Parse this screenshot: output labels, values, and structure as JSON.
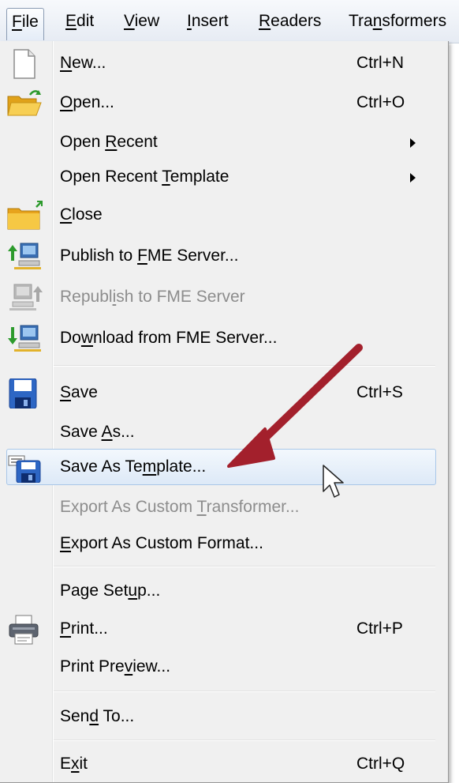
{
  "menubar": {
    "items": [
      {
        "pre": "",
        "acc": "F",
        "post": "ile"
      },
      {
        "pre": "",
        "acc": "E",
        "post": "dit"
      },
      {
        "pre": "",
        "acc": "V",
        "post": "iew"
      },
      {
        "pre": "",
        "acc": "I",
        "post": "nsert"
      },
      {
        "pre": "",
        "acc": "R",
        "post": "eaders"
      },
      {
        "pre": "Tra",
        "acc": "n",
        "post": "sformers"
      }
    ]
  },
  "file_menu": {
    "new": {
      "pre": "",
      "acc": "N",
      "post": "ew...",
      "shortcut": "Ctrl+N"
    },
    "open": {
      "pre": "",
      "acc": "O",
      "post": "pen...",
      "shortcut": "Ctrl+O"
    },
    "open_recent": {
      "pre": "Open ",
      "acc": "R",
      "post": "ecent"
    },
    "open_recent_template": {
      "pre": "Open Recent ",
      "acc": "T",
      "post": "emplate"
    },
    "close": {
      "pre": "",
      "acc": "C",
      "post": "lose"
    },
    "publish": {
      "pre": "Publish to ",
      "acc": "F",
      "post": "ME Server..."
    },
    "republish": {
      "pre": "Republ",
      "acc": "i",
      "post": "sh to FME Server"
    },
    "download": {
      "pre": "Do",
      "acc": "w",
      "post": "nload from FME Server..."
    },
    "save": {
      "pre": "",
      "acc": "S",
      "post": "ave",
      "shortcut": "Ctrl+S"
    },
    "save_as": {
      "pre": "Save ",
      "acc": "A",
      "post": "s..."
    },
    "save_as_template": {
      "pre": "Save As Te",
      "acc": "m",
      "post": "plate..."
    },
    "export_transformer": {
      "pre": "Export As Custom ",
      "acc": "T",
      "post": "ransformer..."
    },
    "export_format": {
      "pre": "",
      "acc": "E",
      "post": "xport As Custom Format..."
    },
    "page_setup": {
      "pre": "Page Set",
      "acc": "u",
      "post": "p..."
    },
    "print": {
      "pre": "",
      "acc": "P",
      "post": "rint...",
      "shortcut": "Ctrl+P"
    },
    "print_preview": {
      "pre": "Print Pre",
      "acc": "v",
      "post": "iew..."
    },
    "send_to": {
      "pre": "Sen",
      "acc": "d",
      "post": " To..."
    },
    "exit": {
      "pre": "E",
      "acc": "x",
      "post": "it",
      "shortcut": "Ctrl+Q"
    }
  },
  "icons": {
    "new": "new-document-icon",
    "open": "open-folder-icon",
    "close": "close-folder-icon",
    "publish": "publish-server-icon",
    "republish": "republish-server-icon",
    "download": "download-server-icon",
    "save": "save-disk-icon",
    "save_as_template": "save-template-icon",
    "print": "printer-icon"
  },
  "colors": {
    "annotation_arrow": "#a3202c",
    "highlight_border": "#a9c7e8",
    "disabled_text": "#8d8d8d",
    "menu_bg": "#f0f0f0"
  }
}
